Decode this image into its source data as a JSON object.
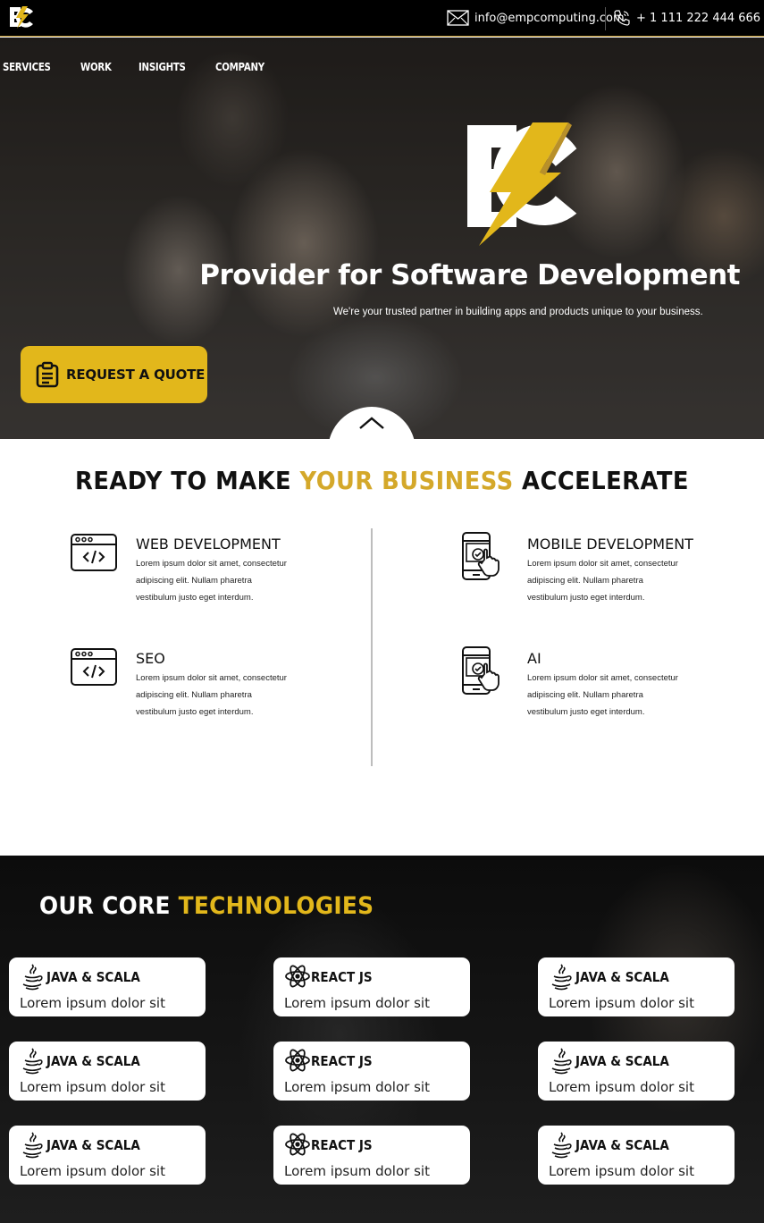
{
  "topbar": {
    "email": "info@empcomputing.com",
    "phone": "+ 1 111 222 444 666",
    "logo": "ec-lightning-logo"
  },
  "nav": {
    "items": [
      "SERVICES",
      "WORK",
      "INSIGHTS",
      "COMPANY"
    ]
  },
  "hero": {
    "title": "Provider for Software Development",
    "subtitle": "We're your trusted partner in building apps and products unique to your business.",
    "cta_label": "REQUEST A QUOTE",
    "cta_icon": "clipboard-icon",
    "scroll_icon": "chevron-up-icon"
  },
  "services": {
    "heading_pre": "READY TO MAKE ",
    "heading_accent": "YOUR BUSINESS",
    "heading_post": " ACCELERATE",
    "items": [
      {
        "title": "WEB DEVELOPMENT",
        "text": "Lorem ipsum dolor sit amet, consectetur adipiscing elit. Nullam pharetra vestibulum justo eget interdum.",
        "icon": "code-window-icon"
      },
      {
        "title": "MOBILE DEVELOPMENT",
        "text": "Lorem ipsum dolor sit amet, consectetur adipiscing elit. Nullam pharetra vestibulum justo eget interdum.",
        "icon": "mobile-touch-icon"
      },
      {
        "title": "SEO",
        "text": "Lorem ipsum dolor sit amet, consectetur adipiscing elit. Nullam pharetra vestibulum justo eget interdum.",
        "icon": "code-window-icon"
      },
      {
        "title": "AI",
        "text": "Lorem ipsum dolor sit amet, consectetur adipiscing elit. Nullam pharetra vestibulum justo eget interdum.",
        "icon": "mobile-touch-icon"
      }
    ]
  },
  "tech": {
    "heading_pre": "OUR CORE ",
    "heading_accent": "TECHNOLOGIES",
    "cards": [
      {
        "title": "JAVA & SCALA",
        "desc": "Lorem ipsum dolor sit",
        "icon": "java-icon"
      },
      {
        "title": "REACT JS",
        "desc": "Lorem ipsum dolor sit",
        "icon": "react-icon"
      },
      {
        "title": "JAVA & SCALA",
        "desc": "Lorem ipsum dolor sit",
        "icon": "java-icon"
      },
      {
        "title": "JAVA & SCALA",
        "desc": "Lorem ipsum dolor sit",
        "icon": "java-icon"
      },
      {
        "title": "REACT JS",
        "desc": "Lorem ipsum dolor sit",
        "icon": "react-icon"
      },
      {
        "title": "JAVA & SCALA",
        "desc": "Lorem ipsum dolor sit",
        "icon": "java-icon"
      },
      {
        "title": "JAVA & SCALA",
        "desc": "Lorem ipsum dolor sit",
        "icon": "java-icon"
      },
      {
        "title": "REACT JS",
        "desc": "Lorem ipsum dolor sit",
        "icon": "react-icon"
      },
      {
        "title": "JAVA & SCALA",
        "desc": "Lorem ipsum dolor sit",
        "icon": "java-icon"
      }
    ]
  },
  "colors": {
    "accent": "#e2b71b",
    "accent_text": "#d4a82a",
    "dark": "#000000"
  }
}
